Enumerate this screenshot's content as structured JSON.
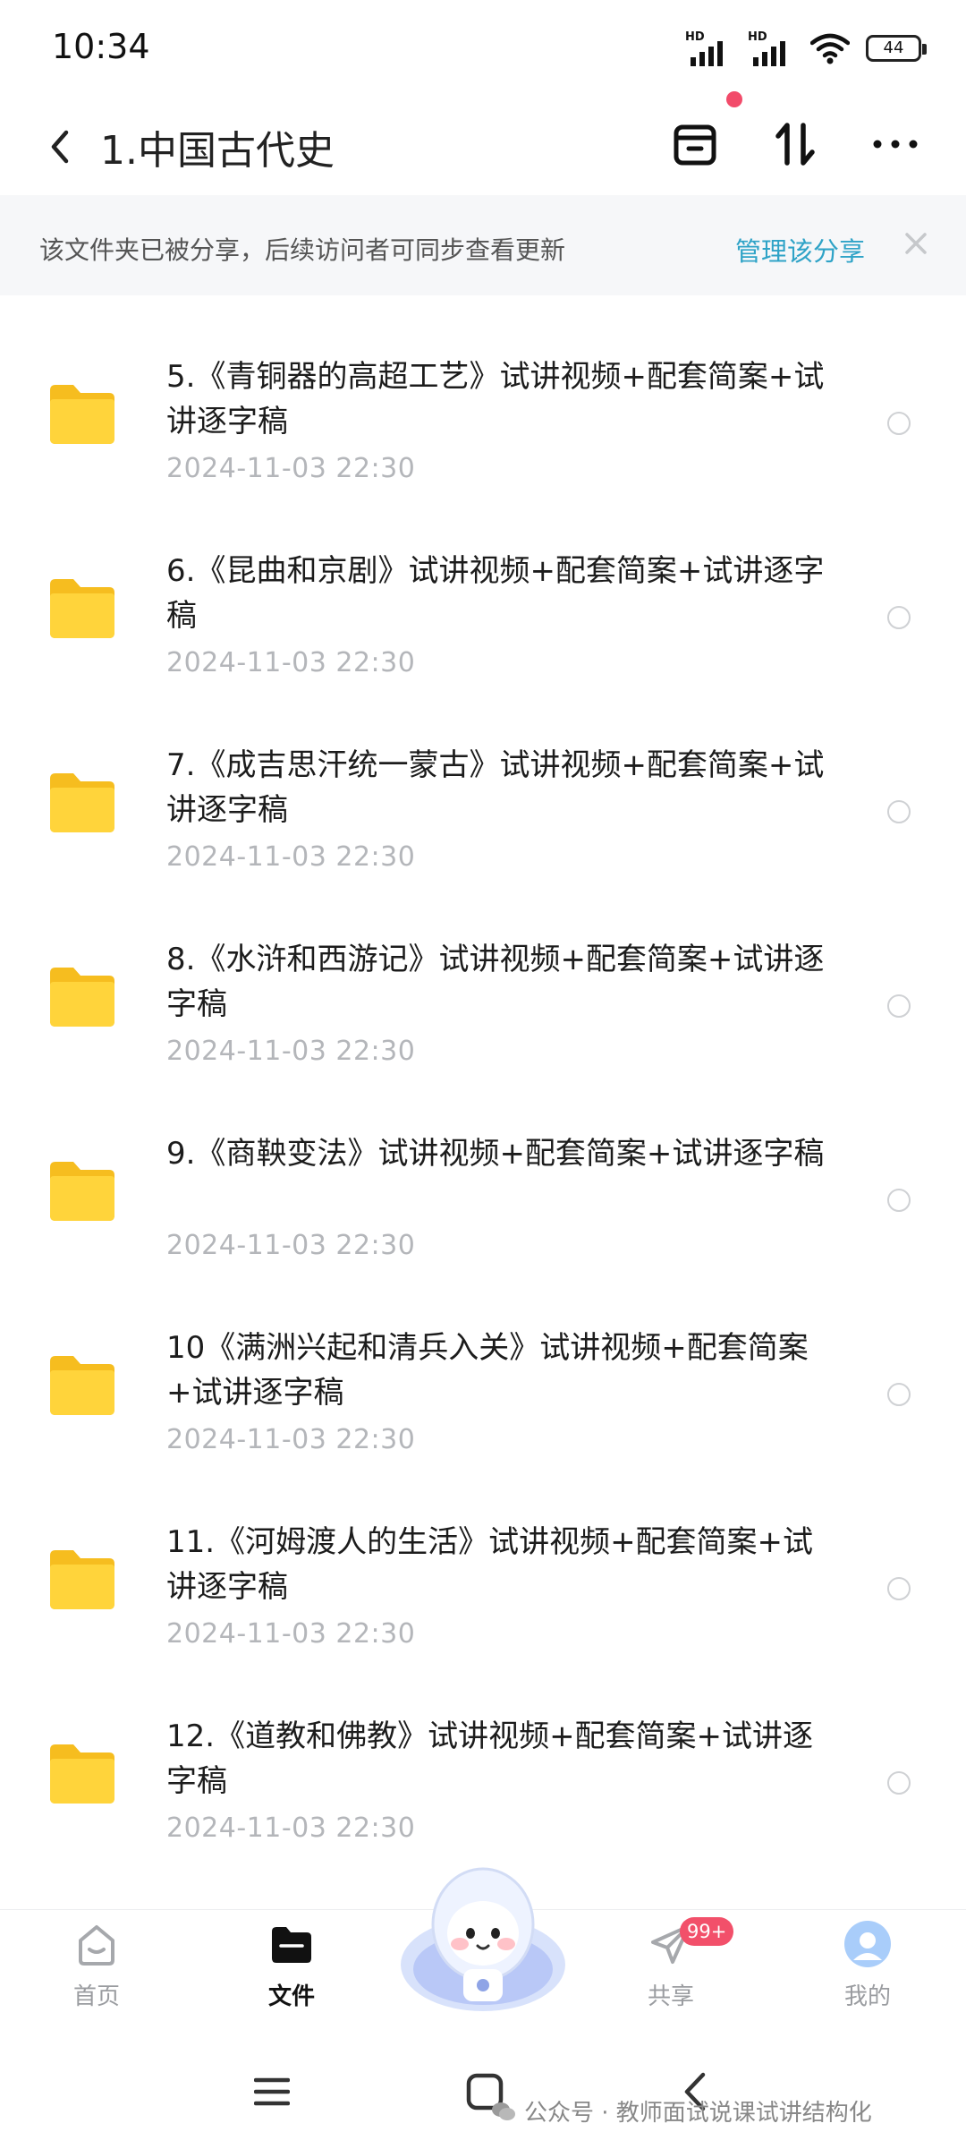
{
  "status_bar": {
    "time": "10:34",
    "signal_label_1": "HD",
    "signal_label_2": "HD",
    "battery": "44"
  },
  "header": {
    "title": "1.中国古代史",
    "icons": [
      "back-icon",
      "archive-icon",
      "sort-icon",
      "more-icon"
    ]
  },
  "share_banner": {
    "text": "该文件夹已被分享，后续访问者可同步查看更新",
    "manage_label": "管理该分享"
  },
  "files": [
    {
      "name": "5.《青铜器的高超工艺》试讲视频+配套简案+试讲逐字稿",
      "date": "2024-11-03  22:30"
    },
    {
      "name": "6.《昆曲和京剧》试讲视频+配套简案+试讲逐字稿",
      "date": "2024-11-03  22:30"
    },
    {
      "name": "7.《成吉思汗统一蒙古》试讲视频+配套简案+试讲逐字稿",
      "date": "2024-11-03  22:30"
    },
    {
      "name": "8.《水浒和西游记》试讲视频+配套简案+试讲逐字稿",
      "date": "2024-11-03  22:30"
    },
    {
      "name": "9.《商鞅变法》试讲视频+配套简案+试讲逐字稿",
      "date": "2024-11-03  22:30"
    },
    {
      "name": "10《满洲兴起和清兵入关》试讲视频+配套简案+试讲逐字稿",
      "date": "2024-11-03  22:30"
    },
    {
      "name": "11.《河姆渡人的生活》试讲视频+配套简案+试讲逐字稿",
      "date": "2024-11-03  22:30"
    },
    {
      "name": "12.《道教和佛教》试讲视频+配套简案+试讲逐字稿",
      "date": "2024-11-03  22:30"
    }
  ],
  "bottom_nav": {
    "home": "首页",
    "files": "文件",
    "share": "共享",
    "share_badge": "99+",
    "mine": "我的"
  },
  "watermark": "公众号 · 教师面试说课试讲结构化",
  "colors": {
    "accent": "#2fa3c7",
    "badge": "#f2506a",
    "folder": "#ffd43b",
    "date_gray": "#b4b6ba"
  }
}
